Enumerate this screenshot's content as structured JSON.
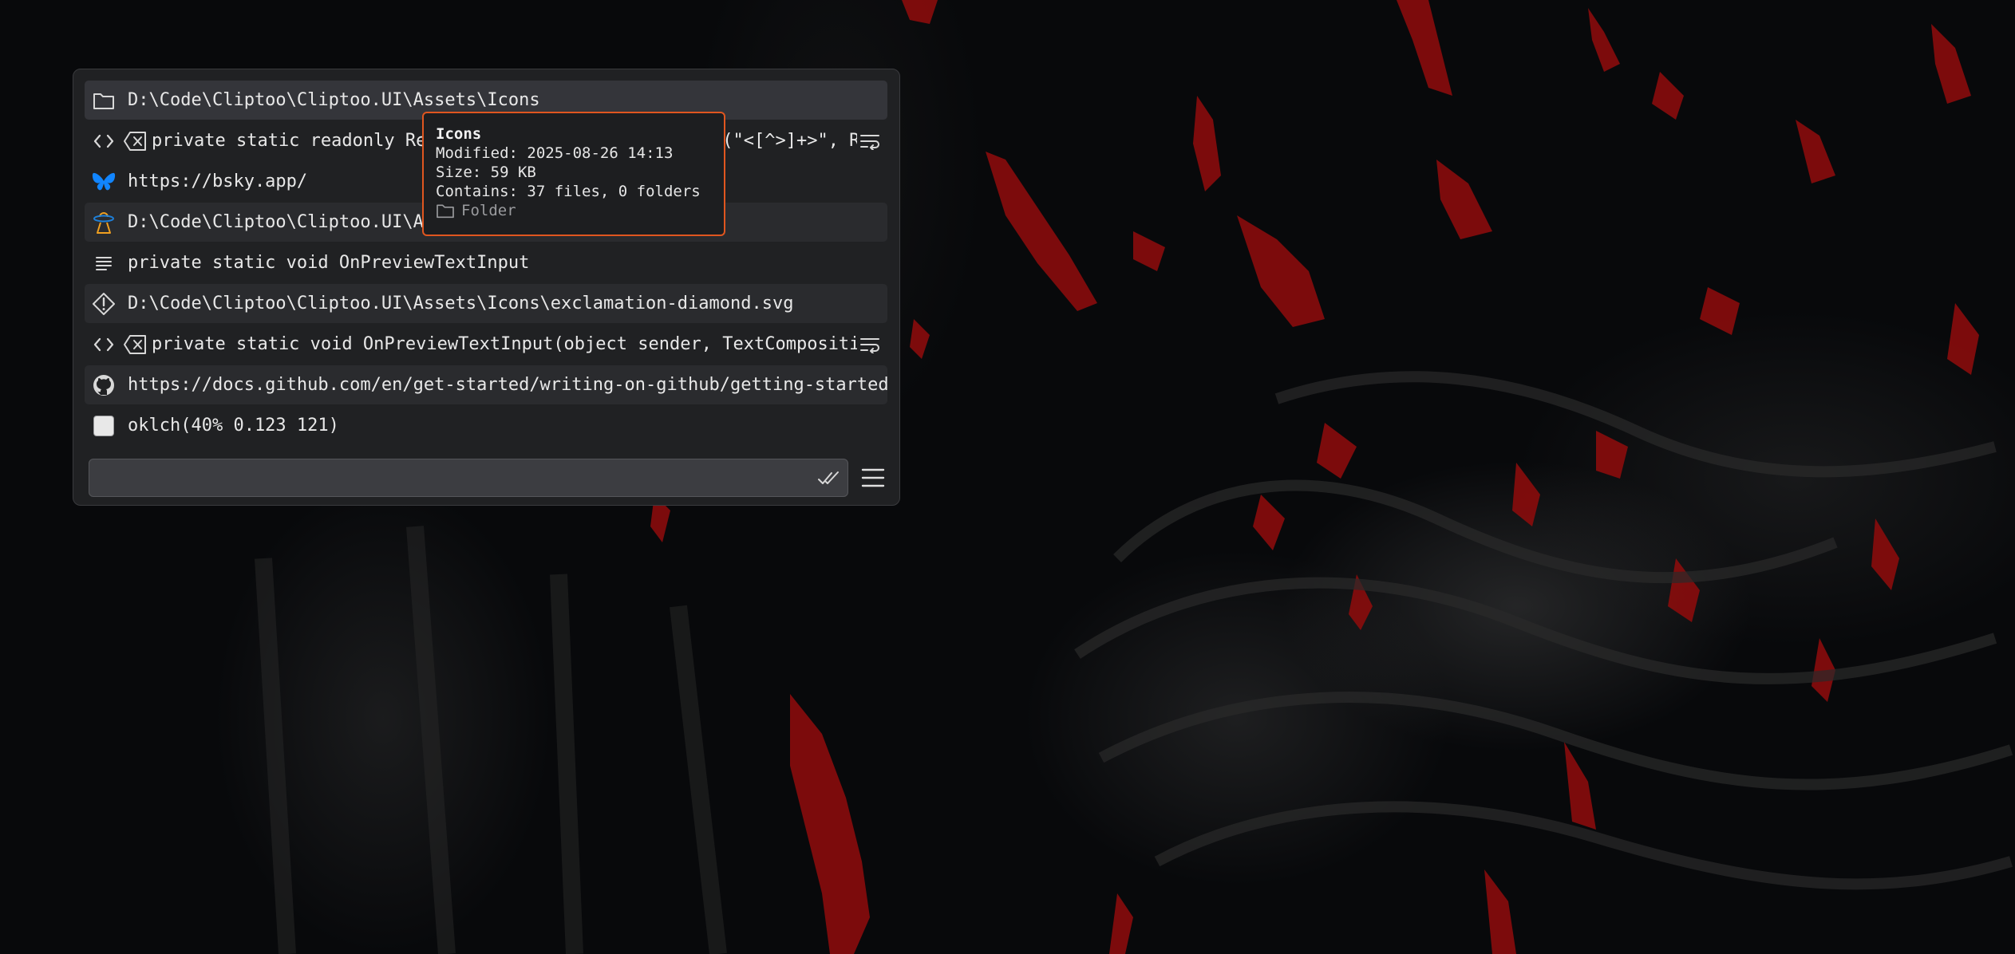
{
  "clipboard_items": [
    {
      "icon": "folder-icon",
      "text": "D:\\Code\\Cliptoo\\Cliptoo.UI\\Assets\\Icons",
      "selected": true
    },
    {
      "icon": "code-icon",
      "text": "private static readonly Regex HtmlTagRegex = new Regex(\"<[^>]+>\", Regex",
      "secondary_icon": "clear-format-icon",
      "trailing_icon": "wrap-text-icon"
    },
    {
      "icon": "bluesky-icon",
      "text": "https://bsky.app/"
    },
    {
      "icon": "ufo-icon",
      "text": "D:\\Code\\Cliptoo\\Cliptoo.UI\\Assets\\Icons\\ufo.svg"
    },
    {
      "icon": "text-lines-icon",
      "text": "private static void OnPreviewTextInput"
    },
    {
      "icon": "exclamation-diamond-icon",
      "text": "D:\\Code\\Cliptoo\\Cliptoo.UI\\Assets\\Icons\\exclamation-diamond.svg"
    },
    {
      "icon": "code-icon",
      "text": "private static void OnPreviewTextInput(object sender, TextCompositi",
      "secondary_icon": "clear-format-icon",
      "trailing_icon": "wrap-text-icon"
    },
    {
      "icon": "github-icon",
      "text": "https://docs.github.com/en/get-started/writing-on-github/getting-started-"
    },
    {
      "icon": "color-swatch-icon",
      "text": "oklch(40% 0.123 121)",
      "swatch_color": "#e8e8e8"
    }
  ],
  "search": {
    "value": "",
    "placeholder": ""
  },
  "tooltip": {
    "title": "Icons",
    "modified": "Modified: 2025-08-26 14:13",
    "size": "Size: 59 KB",
    "contains": "Contains: 37 files, 0 folders",
    "type": "Folder"
  },
  "colors": {
    "accent": "#e0561f",
    "bluesky": "#1185fe",
    "ufo": "#f0a020"
  }
}
